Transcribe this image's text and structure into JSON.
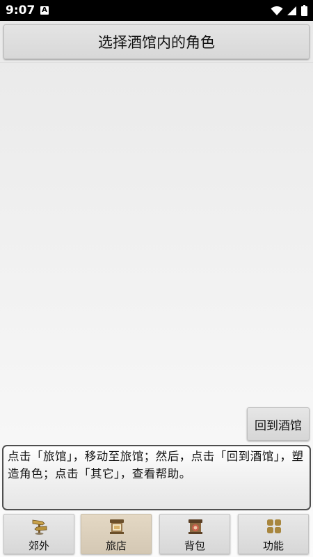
{
  "status_bar": {
    "time": "9:07",
    "app_icon_letter": "A",
    "icons": [
      "wifi-icon",
      "signal-icon",
      "battery-icon"
    ]
  },
  "header": {
    "title": "选择酒馆内的角色"
  },
  "actions": {
    "back_to_tavern": "回到酒馆"
  },
  "message": {
    "text": "点击「旅馆」，移动至旅馆；然后，点击「回到酒馆」，塑造角色；点击「其它」，查看帮助。"
  },
  "tabs": [
    {
      "label": "郊外",
      "icon": "signpost-icon",
      "selected": false
    },
    {
      "label": "旅店",
      "icon": "inn-icon",
      "selected": true
    },
    {
      "label": "背包",
      "icon": "backpack-icon",
      "selected": false
    },
    {
      "label": "功能",
      "icon": "grid-icon",
      "selected": false
    }
  ],
  "colors": {
    "tab_selected": "#d4c8b4",
    "status_bar": "#000000"
  }
}
